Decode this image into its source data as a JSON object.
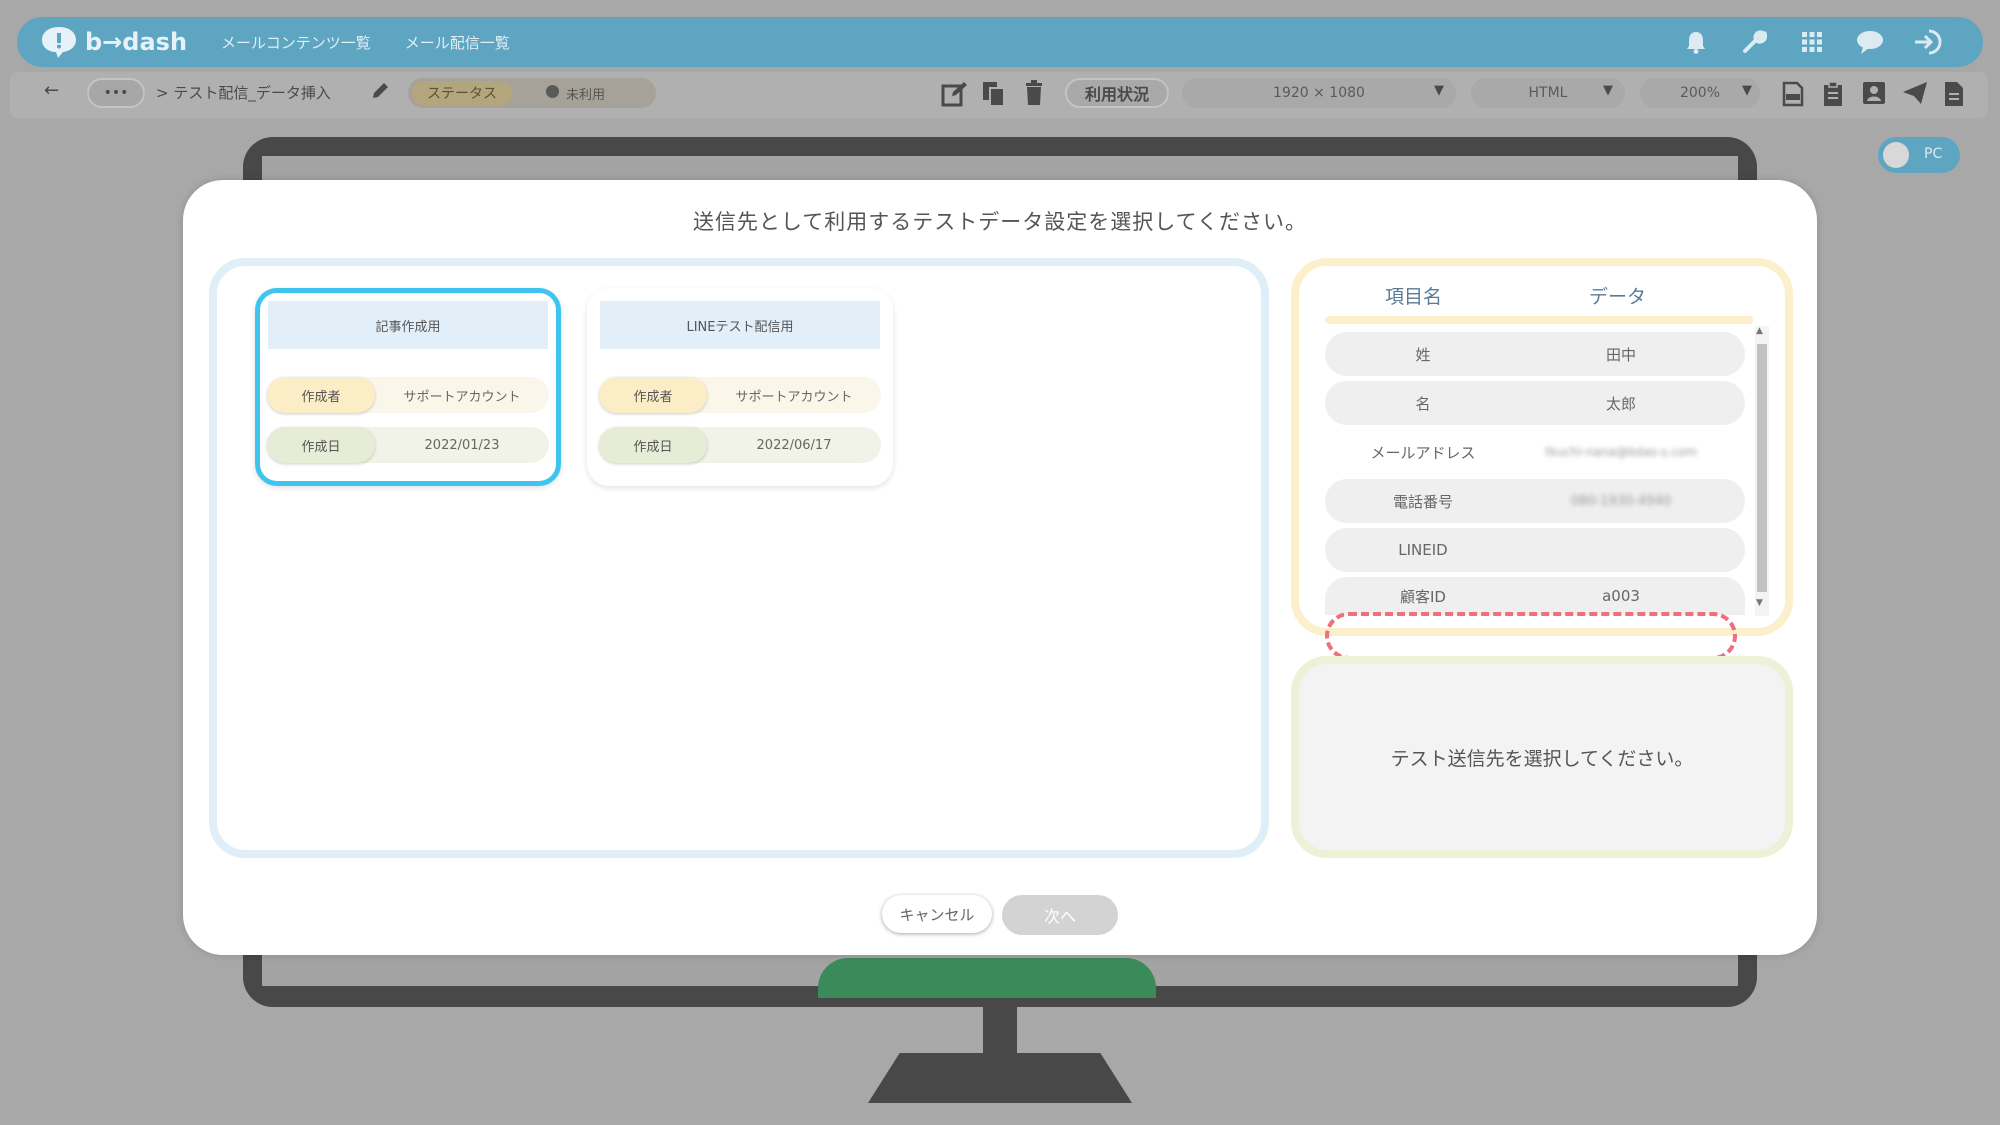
{
  "app": {
    "logo_text": "b→dash"
  },
  "nav": {
    "item1": "メールコンテンツ一覧",
    "item2": "メール配信一覧"
  },
  "toolbar": {
    "back_icon": "←",
    "more": "•••",
    "breadcrumb": "> テスト配信_データ挿入",
    "status_label": "ステータス",
    "status_value": "未利用",
    "usage_label": "利用状況",
    "resolution": "1920 × 1080",
    "format": "HTML",
    "zoom": "200%"
  },
  "toggle": {
    "label": "PC"
  },
  "modal": {
    "title": "送信先として利用するテストデータ設定を選択してください。",
    "cards": [
      {
        "title": "記事作成用",
        "creator_label": "作成者",
        "creator": "サポートアカウント",
        "date_label": "作成日",
        "date": "2022/01/23"
      },
      {
        "title": "LINEテスト配信用",
        "creator_label": "作成者",
        "creator": "サポートアカウント",
        "date_label": "作成日",
        "date": "2022/06/17"
      }
    ],
    "data_header": {
      "col1": "項目名",
      "col2": "データ"
    },
    "data_rows": [
      {
        "key": "姓",
        "value": "田中"
      },
      {
        "key": "名",
        "value": "太郎"
      },
      {
        "key": "メールアドレス",
        "value": "tkuchi-nana@bdas-s.com"
      },
      {
        "key": "電話番号",
        "value": "080-1930-4940"
      },
      {
        "key": "LINEID",
        "value": ""
      },
      {
        "key": "顧客ID",
        "value": "a003"
      }
    ],
    "message": "テスト送信先を選択してください。",
    "cancel": "キャンセル",
    "next": "次へ"
  }
}
